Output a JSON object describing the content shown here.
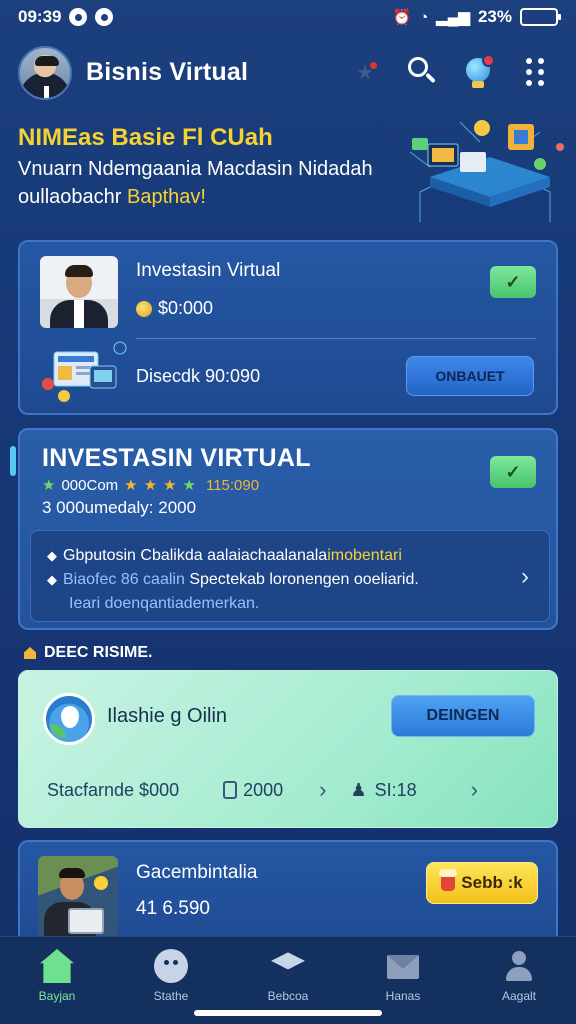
{
  "status_bar": {
    "time": "09:39",
    "battery": "23%",
    "battery_level": 0.23
  },
  "header": {
    "title": "Bisnis Virtual"
  },
  "hero": {
    "headline": "NIMEas Basie Fl CUah",
    "sub1": "Vnuarn Ndemgaania Macdasin Nidadah",
    "sub2": "oullaobachr",
    "sub2_highlight": "Bapthav!"
  },
  "card1": {
    "title": "Investasin Virtual",
    "price": "$0:000",
    "description": "Disecdk 90:090",
    "action": "ONBAUET"
  },
  "card2": {
    "title": "INVESTASIN VIRTUAL",
    "rating_label": "000Com",
    "rating_value": "115:090",
    "meta": "3  000umedaly: 2000",
    "line1": "Gbputosin Cbalikda aalaiachaalanala",
    "line1_hl": "imobentari",
    "line2_lb": "Biaofec 86 caalin",
    "line2": "Spectekab loronengen ooeliarid.",
    "line3": "Ieari doenqantiademerkan."
  },
  "section": {
    "label": "DEEC RISIME."
  },
  "card3": {
    "title": "Ilashie g Oilin",
    "button": "DEINGEN",
    "stat1": "Stacfarnde $000",
    "stat2": "2000",
    "stat3": "SI:18"
  },
  "card4": {
    "title": "Gacembintalia",
    "price": "41 6.590",
    "button": "Sebb :k"
  },
  "bottom_nav": [
    {
      "label": "Bayjan",
      "icon": "home-icon",
      "active": true
    },
    {
      "label": "Stathe",
      "icon": "face-icon",
      "active": false
    },
    {
      "label": "Bebcoa",
      "icon": "graduation-cap-icon",
      "active": false
    },
    {
      "label": "Hanas",
      "icon": "mail-icon",
      "active": false
    },
    {
      "label": "Aagalt",
      "icon": "user-icon",
      "active": false
    }
  ],
  "colors": {
    "accent_yellow": "#f6d233",
    "accent_green": "#48c46b",
    "background": "#1c3f7d"
  }
}
